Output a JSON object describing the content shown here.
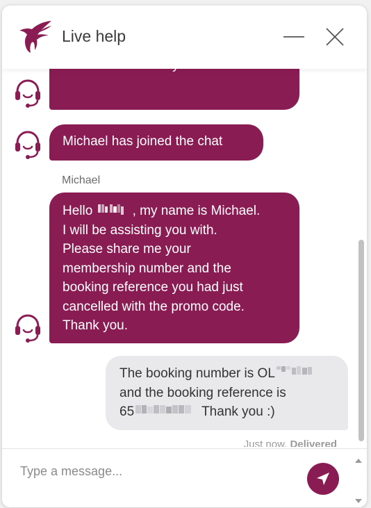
{
  "header": {
    "title": "Live help",
    "logo_icon": "oryx-logo-icon",
    "minimize_icon": "minimize-icon",
    "close_icon": "close-icon"
  },
  "colors": {
    "brand": "#8a1c54",
    "user_bubble": "#e9e9ec",
    "agent_text": "#ffffff",
    "user_text": "#333333"
  },
  "messages": [
    {
      "from": "agent",
      "text": "over to them for further\nassistance. Thank you."
    },
    {
      "from": "agent",
      "text": "Michael has joined the chat"
    },
    {
      "from": "agent",
      "sender": "Michael",
      "text_parts": [
        "Hello ",
        ", my name is Michael.\nI will be assisting you with.\nPlease share me your\nmembership number and the\nbooking reference you had just\ncancelled with the promo code.\nThank you."
      ]
    },
    {
      "from": "user",
      "text_parts": [
        "The booking number is OL",
        "\nand the booking reference is\n65",
        " Thank you :)"
      ]
    }
  ],
  "status": {
    "time": "Just now.",
    "state": "Delivered"
  },
  "composer": {
    "placeholder": "Type a message...",
    "send_icon": "send-icon"
  }
}
